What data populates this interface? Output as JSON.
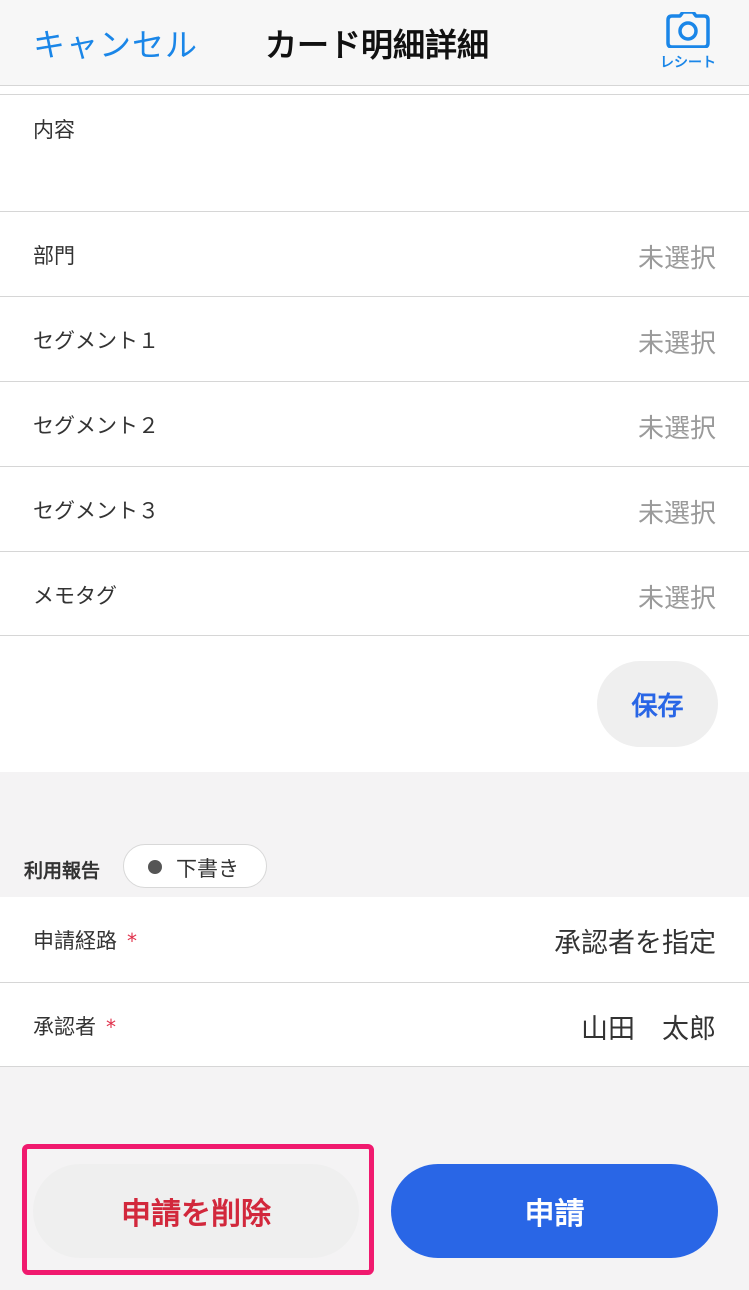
{
  "navbar": {
    "cancel_label": "キャンセル",
    "title": "カード明細詳細",
    "receipt_label": "レシート",
    "receipt_icon": "camera-icon"
  },
  "form": {
    "content_label": "内容",
    "rows": [
      {
        "label": "部門",
        "value": "未選択"
      },
      {
        "label": "セグメント１",
        "value": "未選択"
      },
      {
        "label": "セグメント２",
        "value": "未選択"
      },
      {
        "label": "セグメント３",
        "value": "未選択"
      },
      {
        "label": "メモタグ",
        "value": "未選択"
      }
    ],
    "save_label": "保存"
  },
  "report": {
    "label": "利用報告",
    "status": "下書き",
    "route_label": "申請経路",
    "route_value": "承認者を指定",
    "approver_label": "承認者",
    "approver_value": "山田　太郎",
    "required_mark": "*"
  },
  "actions": {
    "delete_label": "申請を削除",
    "apply_label": "申請"
  },
  "colors": {
    "accent": "#1a86e8",
    "primary_button": "#2966e6",
    "danger_text": "#d2283c",
    "highlight": "#f0196e"
  }
}
